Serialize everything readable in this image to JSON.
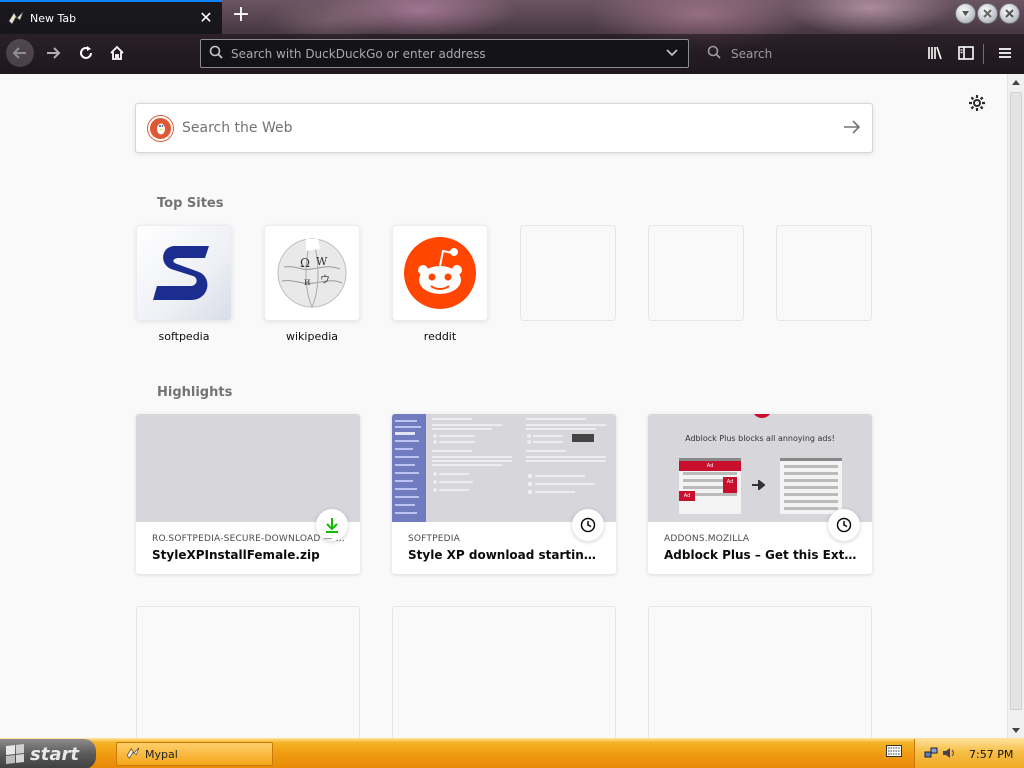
{
  "tab": {
    "title": "New Tab",
    "close": "✕",
    "new_tab": "+"
  },
  "window_controls": [
    "▾",
    "✕",
    "✕"
  ],
  "nav": {
    "back": "←",
    "forward": "→",
    "reload": "↻",
    "home": "⌂"
  },
  "urlbar": {
    "placeholder": "Search with DuckDuckGo or enter address",
    "search_icon": "search-icon",
    "dropdown": "⌄"
  },
  "searchbar": {
    "placeholder": "Search"
  },
  "toolbar": {
    "library": "|||\\",
    "sidebar": "◫",
    "menu": "☰"
  },
  "newtab": {
    "settings_icon": "⚙",
    "web_search": {
      "placeholder": "Search the Web",
      "go": "→",
      "engine_badge": "DDG"
    },
    "top_sites_title": "Top Sites",
    "top_sites": [
      {
        "label": "softpedia",
        "icon": "softpedia-logo"
      },
      {
        "label": "wikipedia",
        "icon": "wikipedia-logo"
      },
      {
        "label": "reddit",
        "icon": "reddit-logo"
      },
      {
        "label": ""
      },
      {
        "label": ""
      },
      {
        "label": ""
      }
    ],
    "highlights_title": "Highlights",
    "highlights": [
      {
        "host": "RO.SOFTPEDIA-SECURE-DOWNLOAD — ...",
        "title": "StyleXPInstallFemale.zip",
        "badge": "download-icon"
      },
      {
        "host": "SOFTPEDIA",
        "title": "Style XP download starting...",
        "badge": "clock-icon"
      },
      {
        "host": "ADDONS.MOZILLA",
        "title": "Adblock Plus – Get this Extensio...",
        "badge": "clock-icon"
      }
    ],
    "adblock_thumb_heading": "Adblock Plus blocks all annoying ads!",
    "adblock_thumb_ad": "Ad"
  },
  "taskbar": {
    "start": "start",
    "task_item": "Mypal",
    "clock": "7:57 PM"
  },
  "colors": {
    "accent": "#0a84ff",
    "ddg": "#de5833",
    "reddit": "#ff4500",
    "softpedia": "#1b2d8f",
    "download_green": "#12bc00"
  }
}
